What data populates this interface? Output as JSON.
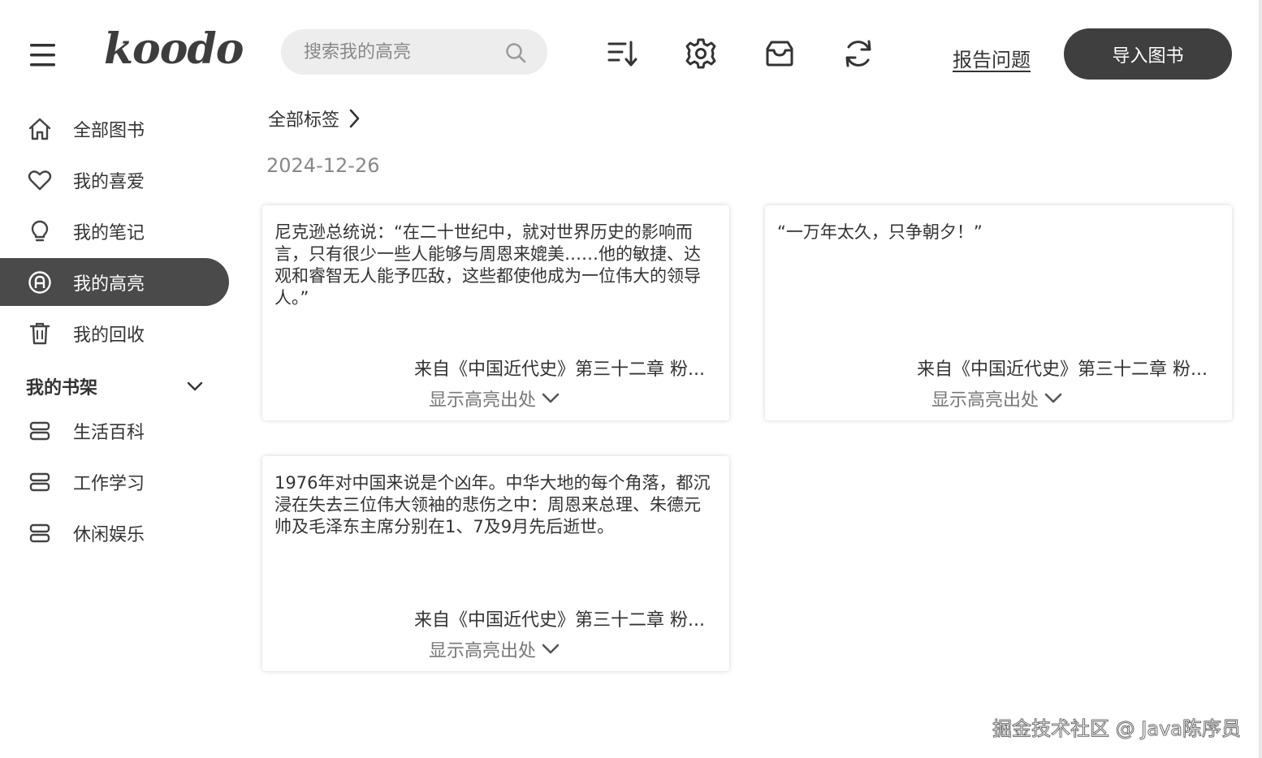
{
  "app": {
    "logo": "koodo"
  },
  "header": {
    "search_placeholder": "搜索我的高亮",
    "report_label": "报告问题",
    "import_label": "导入图书",
    "icons": [
      "sort-icon",
      "gear-icon",
      "inbox-icon",
      "sync-icon"
    ]
  },
  "sidebar": {
    "items": [
      {
        "label": "全部图书",
        "icon": "home-icon"
      },
      {
        "label": "我的喜爱",
        "icon": "heart-icon"
      },
      {
        "label": "我的笔记",
        "icon": "lightbulb-icon"
      },
      {
        "label": "我的高亮",
        "icon": "highlight-icon",
        "active": true
      },
      {
        "label": "我的回收",
        "icon": "trash-icon"
      }
    ],
    "shelf_title": "我的书架",
    "shelves": [
      {
        "label": "生活百科",
        "icon": "shelf-icon"
      },
      {
        "label": "工作学习",
        "icon": "shelf-icon"
      },
      {
        "label": "休闲娱乐",
        "icon": "shelf-icon"
      }
    ]
  },
  "main": {
    "breadcrumb": "全部标签",
    "date": "2024-12-26",
    "cards": [
      {
        "quote": "尼克逊总统说：“在二十世纪中，就对世界历史的影响而言，只有很少一些人能够与周恩来媲美……他的敏捷、达观和睿智无人能予匹敌，这些都使他成为一位伟大的领导人。”",
        "source": "来自《中国近代史》第三十二章 粉...",
        "show_label": "显示高亮出处"
      },
      {
        "quote": "“一万年太久，只争朝夕！”",
        "source": "来自《中国近代史》第三十二章 粉...",
        "show_label": "显示高亮出处"
      },
      {
        "quote": "1976年对中国来说是个凶年。中华大地的每个角落，都沉浸在失去三位伟大领袖的悲伤之中：周恩来总理、朱德元帅及毛泽东主席分别在1、7及9月先后逝世。",
        "source": "来自《中国近代史》第三十二章 粉...",
        "show_label": "显示高亮出处"
      }
    ]
  },
  "watermark": "掘金技术社区 @ Java陈序员",
  "colors": {
    "active_bg": "#4a4a4a",
    "button_bg": "#3f3f3f",
    "search_bg": "#ededed"
  }
}
